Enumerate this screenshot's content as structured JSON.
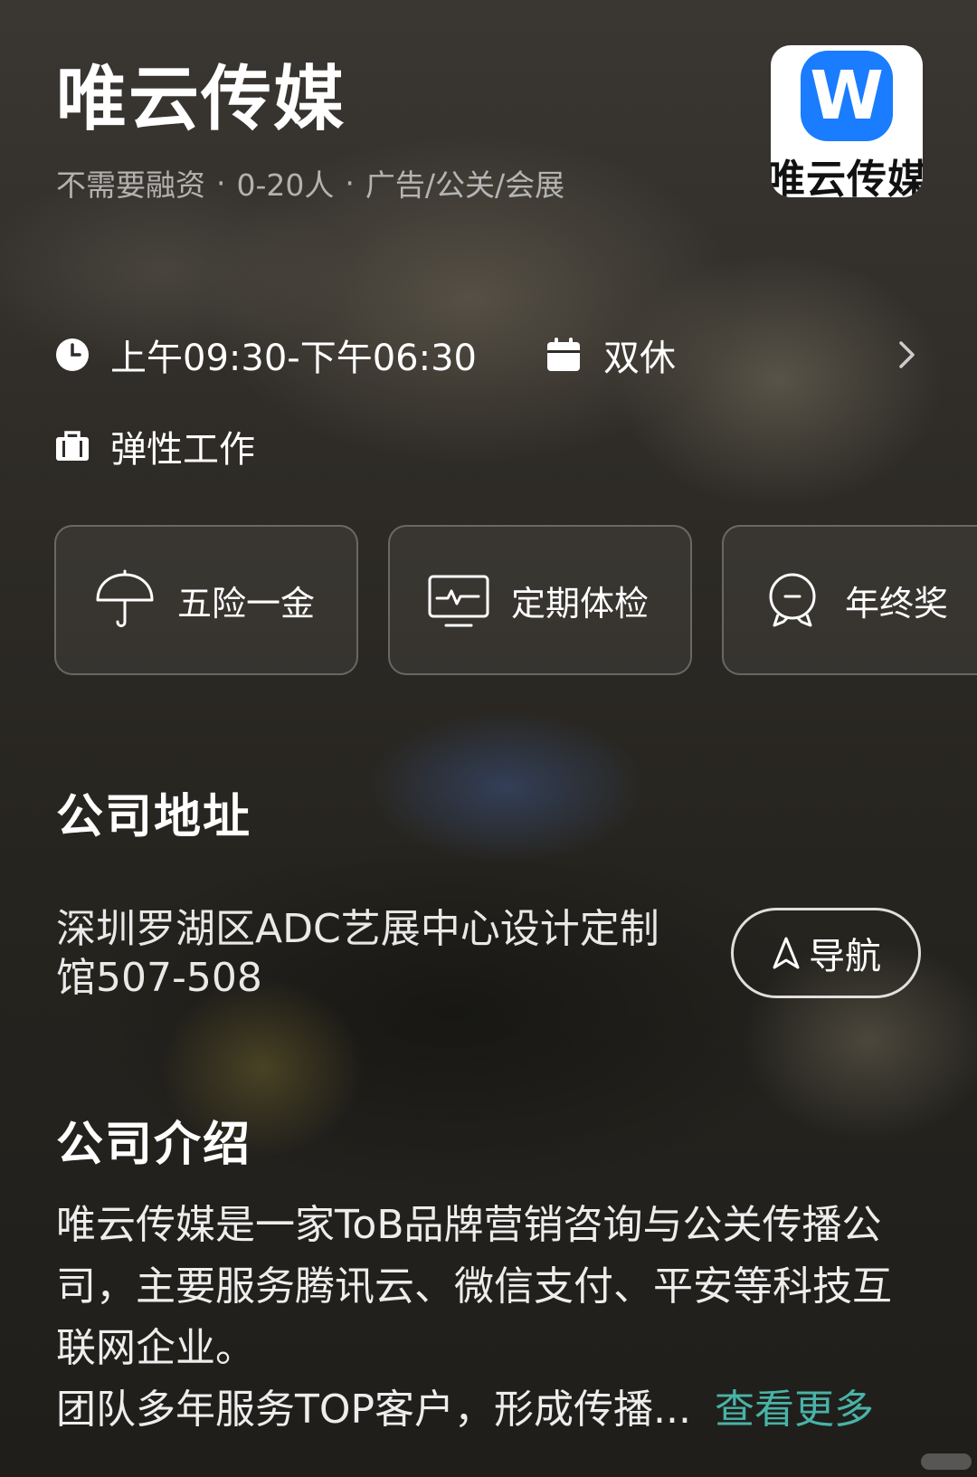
{
  "company": {
    "name": "唯云传媒",
    "financing": "不需要融资",
    "size": "0-20人",
    "industry": "广告/公关/会展",
    "separator": "·",
    "logo_text": "唯云传媒"
  },
  "work": {
    "hours": "上午09:30-下午06:30",
    "rest": "双休",
    "schedule": "弹性工作"
  },
  "benefits": [
    {
      "label": "五险一金",
      "icon": "umbrella-icon"
    },
    {
      "label": "定期体检",
      "icon": "monitor-checkup-icon"
    },
    {
      "label": "年终奖",
      "icon": "medal-icon"
    }
  ],
  "address": {
    "title": "公司地址",
    "text": "深圳罗湖区ADC艺展中心设计定制馆507-508",
    "nav_label": "导航"
  },
  "intro": {
    "title": "公司介绍",
    "text": "唯云传媒是一家ToB品牌营销咨询与公关传播公司，主要服务腾讯云、微信支付、平安等科技互联网企业。",
    "text2": "团队多年服务TOP客户，形成传播...",
    "more_label": "查看更多"
  },
  "colors": {
    "brand_blue": "#1a7cff",
    "link_teal": "#49b3a7"
  }
}
